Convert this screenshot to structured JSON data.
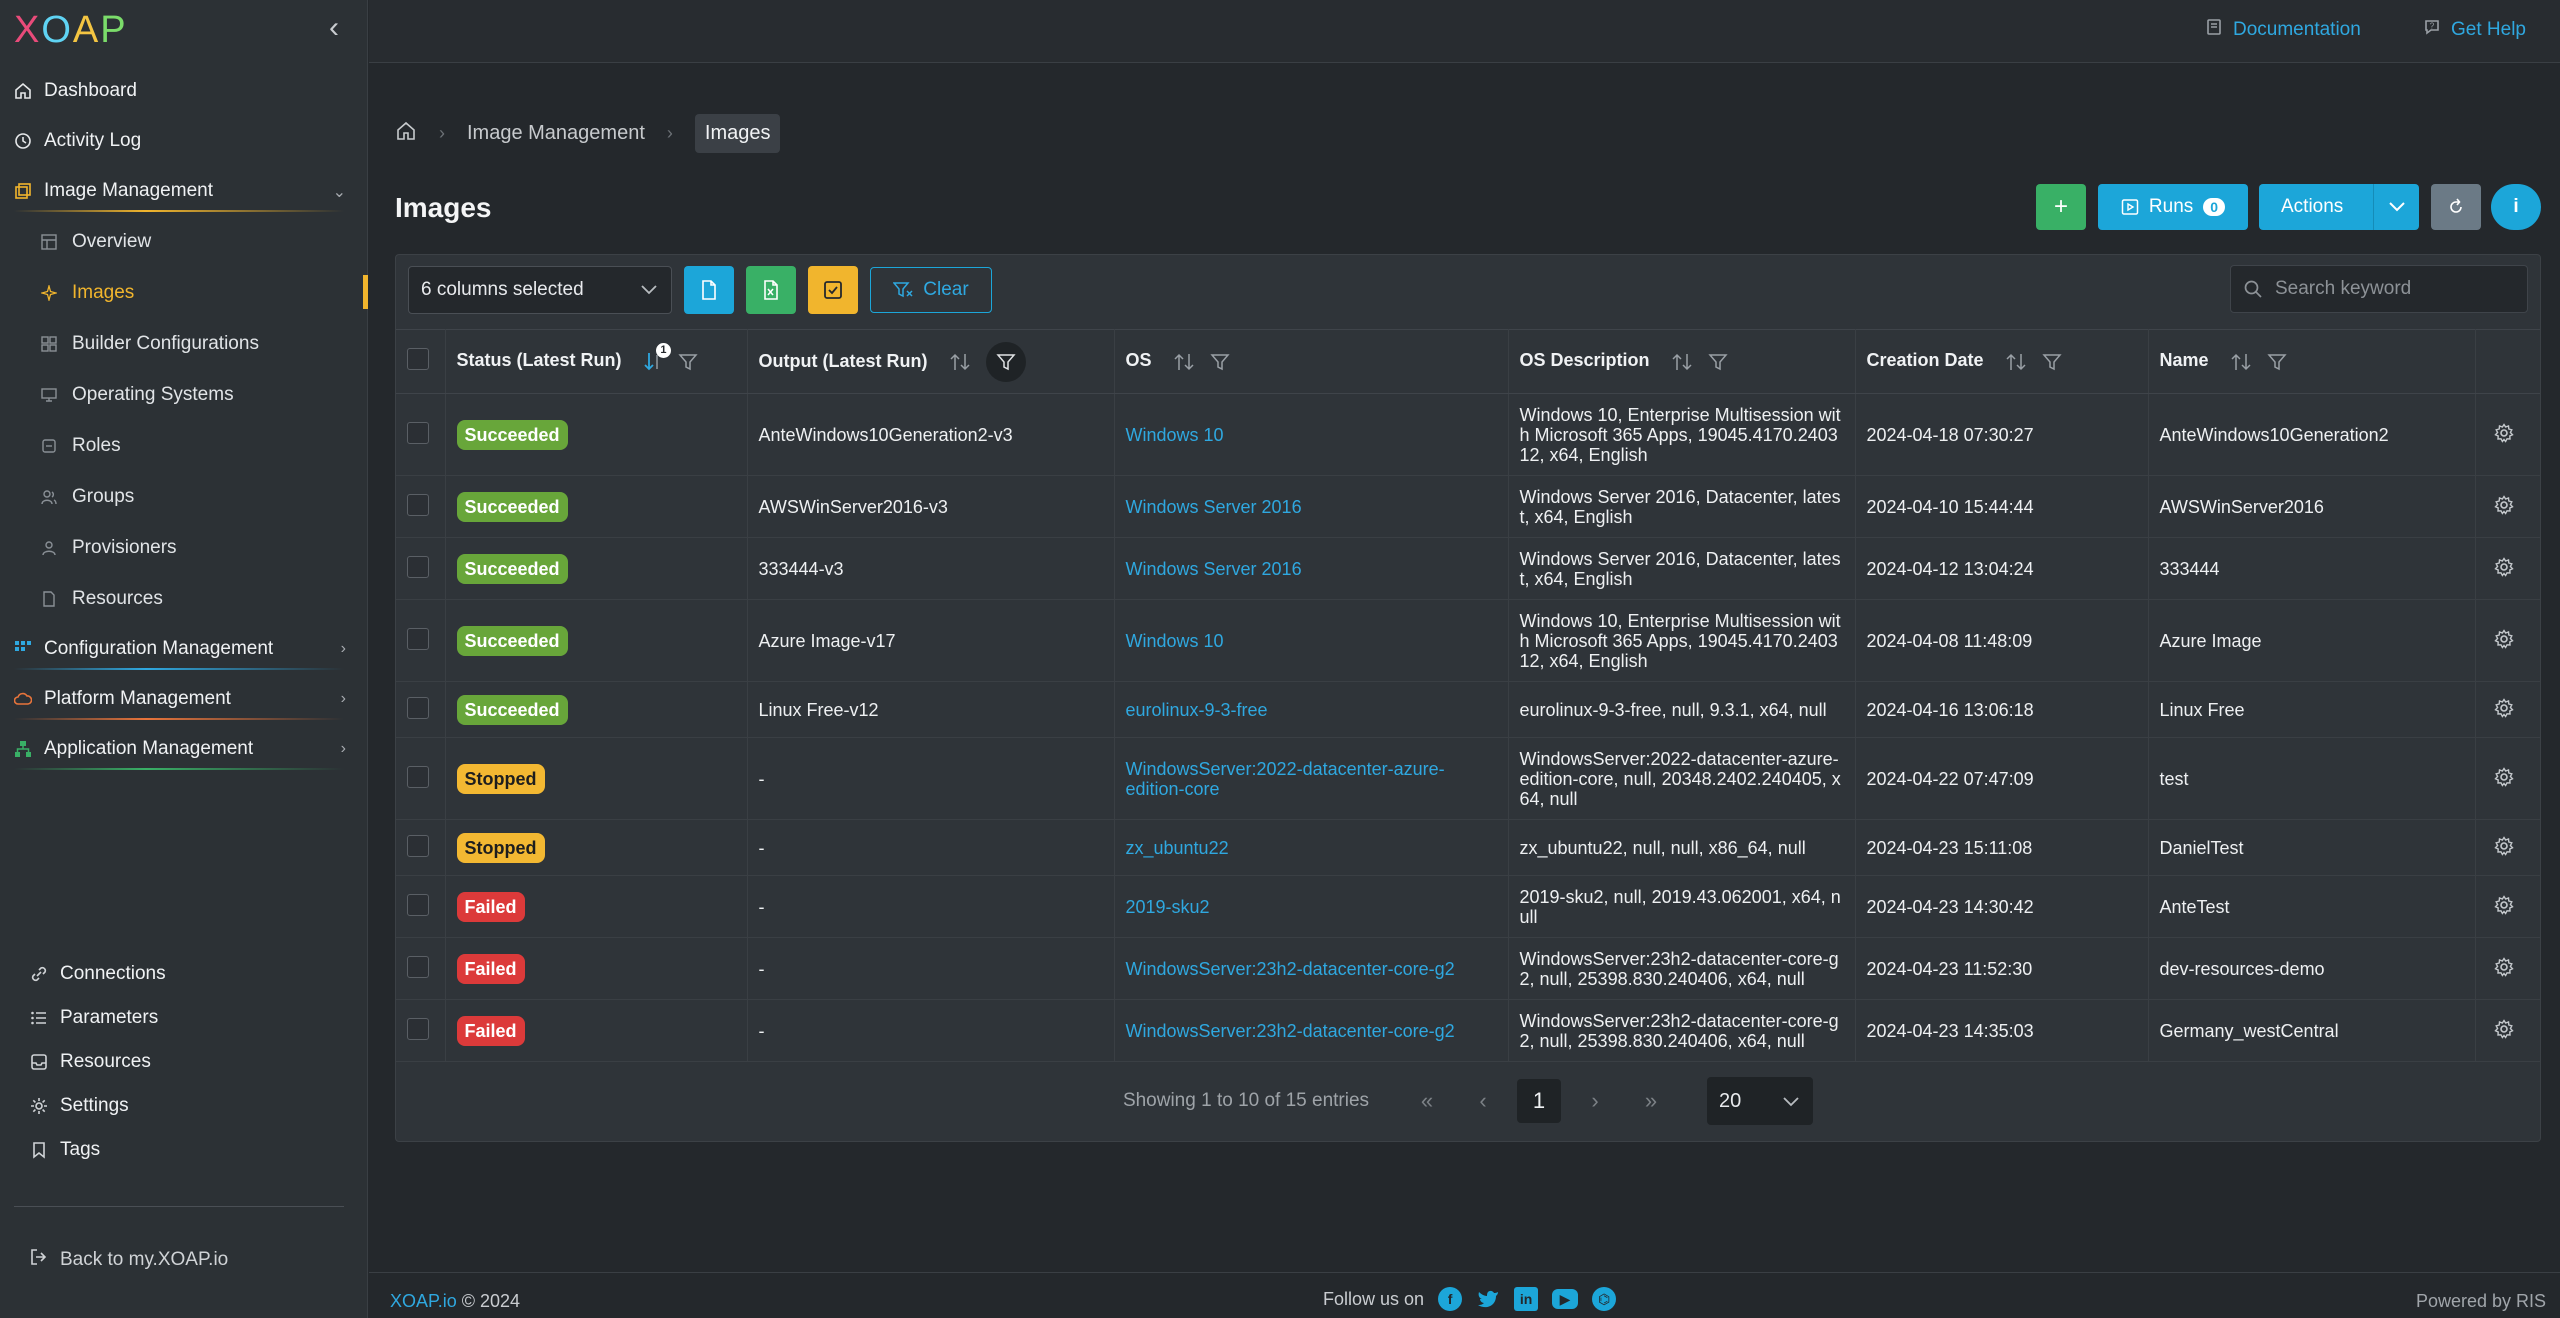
{
  "app": {
    "logo_letters": [
      "X",
      "O",
      "A",
      "P"
    ]
  },
  "sidebar": {
    "items": [
      {
        "label": "Dashboard"
      },
      {
        "label": "Activity Log"
      },
      {
        "label": "Image Management"
      },
      {
        "label": "Overview"
      },
      {
        "label": "Images"
      },
      {
        "label": "Builder Configurations"
      },
      {
        "label": "Operating Systems"
      },
      {
        "label": "Roles"
      },
      {
        "label": "Groups"
      },
      {
        "label": "Provisioners"
      },
      {
        "label": "Resources"
      },
      {
        "label": "Configuration Management"
      },
      {
        "label": "Platform Management"
      },
      {
        "label": "Application Management"
      }
    ],
    "bottom_items": [
      {
        "label": "Connections"
      },
      {
        "label": "Parameters"
      },
      {
        "label": "Resources"
      },
      {
        "label": "Settings"
      },
      {
        "label": "Tags"
      }
    ],
    "back_link": "Back to my.XOAP.io"
  },
  "topbar": {
    "documentation": "Documentation",
    "get_help": "Get Help"
  },
  "breadcrumb": {
    "parent": "Image Management",
    "current": "Images"
  },
  "page_title": "Images",
  "header_buttons": {
    "add": "+",
    "runs": "Runs",
    "runs_count": "0",
    "actions": "Actions",
    "info": "i"
  },
  "toolbar": {
    "columns_selected": "6 columns selected",
    "clear": "Clear",
    "search_placeholder": "Search keyword"
  },
  "table": {
    "columns": [
      "Status (Latest Run)",
      "Output (Latest Run)",
      "OS",
      "OS Description",
      "Creation Date",
      "Name"
    ],
    "status_sort_badge": "1",
    "rows": [
      {
        "status": "Succeeded",
        "output": "AnteWindows10Generation2-v3",
        "os": "Windows 10",
        "os_desc": "Windows 10, Enterprise Multisession with Microsoft 365 Apps, 19045.4170.240312, x64, English",
        "created": "2024-04-18 07:30:27",
        "name": "AnteWindows10Generation2"
      },
      {
        "status": "Succeeded",
        "output": "AWSWinServer2016-v3",
        "os": "Windows Server 2016",
        "os_desc": "Windows Server 2016, Datacenter, latest, x64, English",
        "created": "2024-04-10 15:44:44",
        "name": "AWSWinServer2016"
      },
      {
        "status": "Succeeded",
        "output": "333444-v3",
        "os": "Windows Server 2016",
        "os_desc": "Windows Server 2016, Datacenter, latest, x64, English",
        "created": "2024-04-12 13:04:24",
        "name": "333444"
      },
      {
        "status": "Succeeded",
        "output": "Azure Image-v17",
        "os": "Windows 10",
        "os_desc": "Windows 10, Enterprise Multisession with Microsoft 365 Apps, 19045.4170.240312, x64, English",
        "created": "2024-04-08 11:48:09",
        "name": "Azure Image"
      },
      {
        "status": "Succeeded",
        "output": "Linux Free-v12",
        "os": "eurolinux-9-3-free",
        "os_desc": "eurolinux-9-3-free, null, 9.3.1, x64, null",
        "created": "2024-04-16 13:06:18",
        "name": "Linux Free"
      },
      {
        "status": "Stopped",
        "output": "-",
        "os": "WindowsServer:2022-datacenter-azure-edition-core",
        "os_desc": "WindowsServer:2022-datacenter-azure-edition-core, null, 20348.2402.240405, x64, null",
        "created": "2024-04-22 07:47:09",
        "name": "test"
      },
      {
        "status": "Stopped",
        "output": "-",
        "os": "zx_ubuntu22",
        "os_desc": "zx_ubuntu22, null, null, x86_64, null",
        "created": "2024-04-23 15:11:08",
        "name": "DanielTest"
      },
      {
        "status": "Failed",
        "output": "-",
        "os": "2019-sku2",
        "os_desc": "2019-sku2, null, 2019.43.062001, x64, null",
        "created": "2024-04-23 14:30:42",
        "name": "AnteTest"
      },
      {
        "status": "Failed",
        "output": "-",
        "os": "WindowsServer:23h2-datacenter-core-g2",
        "os_desc": "WindowsServer:23h2-datacenter-core-g2, null, 25398.830.240406, x64, null",
        "created": "2024-04-23 11:52:30",
        "name": "dev-resources-demo"
      },
      {
        "status": "Failed",
        "output": "-",
        "os": "WindowsServer:23h2-datacenter-core-g2",
        "os_desc": "WindowsServer:23h2-datacenter-core-g2, null, 25398.830.240406, x64, null",
        "created": "2024-04-23 14:35:03",
        "name": "Germany_westCentral"
      }
    ]
  },
  "pagination": {
    "info": "Showing 1 to 10 of 15 entries",
    "current_page": "1",
    "page_size": "20"
  },
  "footer": {
    "brand": "XOAP.io",
    "copyright": " © 2024",
    "follow": "Follow us on",
    "powered": "Powered by RIS"
  },
  "colors": {
    "accent": "#1ca6d9",
    "active": "#f1b52d",
    "success": "#68a63a",
    "warning": "#f3b832",
    "danger": "#dc3a3a"
  }
}
